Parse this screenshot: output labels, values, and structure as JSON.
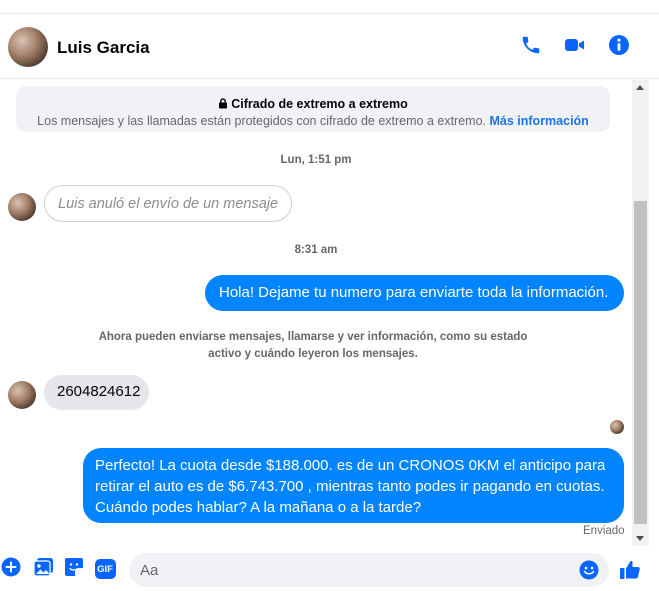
{
  "header": {
    "contact_name": "Luis Garcia",
    "icons": [
      "phone-icon",
      "video-camera-icon",
      "info-icon"
    ]
  },
  "encryption": {
    "title": "Cifrado de extremo a extremo",
    "body": "Los mensajes y las llamadas están protegidos con cifrado de extremo a extremo.",
    "link": "Más información"
  },
  "conversation": {
    "timestamp_1": "Lun, 1:51 pm",
    "unsent_notice": "Luis anuló el envío de un mensaje",
    "timestamp_2": "8:31 am",
    "outgoing_1": "Hola! Dejame tu numero  para enviarte toda la información.",
    "system_notice_line1": "Ahora pueden enviarse mensajes, llamarse y ver información, como su estado",
    "system_notice_line2": "activo y cuándo leyeron los mensajes.",
    "incoming_1": "2604824612",
    "outgoing_2_line1": "Perfecto! La cuota desde $188.000. es de un CRONOS 0KM el anticipo para",
    "outgoing_2_line2": "retirar el auto es de $6.743.700 , mientras tanto podes ir pagando en cuotas.",
    "outgoing_2_line3": "Cuándo podes hablar? A la mañana o a la tarde?",
    "sent_status": "Enviado"
  },
  "composer": {
    "placeholder": "Aa",
    "value": "",
    "gif_label": "GIF",
    "icons": [
      "add-icon",
      "photo-icon",
      "sticker-icon",
      "gif-icon",
      "emoji-icon",
      "thumbs-up-icon"
    ]
  },
  "colors": {
    "accent": "#0084ff",
    "messenger_blue": "#0866ff",
    "link": "#1b74e4",
    "secondary_text": "#65676b",
    "incoming_bubble": "#e4e6eb"
  }
}
